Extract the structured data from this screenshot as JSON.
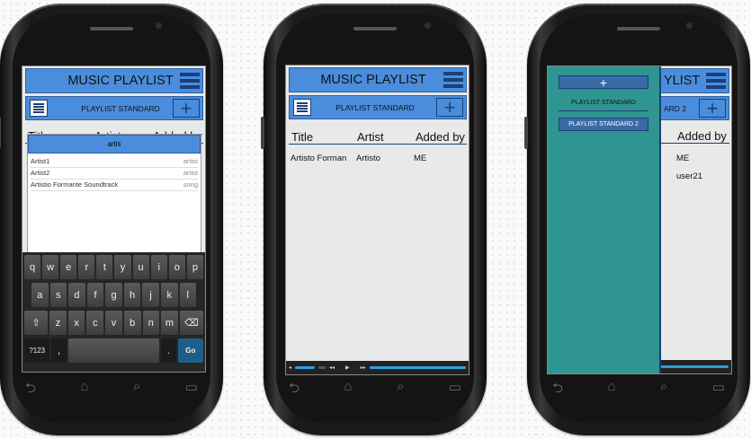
{
  "colors": {
    "header": "#4a8ddc",
    "header_border": "#2f5f9e",
    "drawer": "#2e9590",
    "screen_bg": "#e9e9ea"
  },
  "icons": {
    "menu": "hamburger-icon",
    "list": "list-icon",
    "add": "plus-icon",
    "back": "back-icon",
    "home": "home-icon",
    "search": "search-icon",
    "recent": "recent-apps-icon"
  },
  "header": {
    "title": "MUSIC PLAYLIST",
    "title_partial": "YLIST"
  },
  "subheader": {
    "playlist": "PLAYLIST STANDARD",
    "playlist_partial": "ARD 2",
    "plus": "+"
  },
  "columns": {
    "title": "Title",
    "artist": "Artist",
    "added_by": "Added by",
    "artist_partial": "Artis",
    "added_by_partial": "Added by"
  },
  "search": {
    "query": "artis",
    "results": [
      {
        "name": "Artist1",
        "type": "artist"
      },
      {
        "name": "Artist2",
        "type": "artist"
      },
      {
        "name": "Artistio Formante Soundtrack",
        "type": "song"
      }
    ]
  },
  "keyboard": {
    "row1": [
      "q",
      "w",
      "e",
      "r",
      "t",
      "y",
      "u",
      "i",
      "o",
      "p"
    ],
    "row2": [
      "a",
      "s",
      "d",
      "f",
      "g",
      "h",
      "j",
      "k",
      "l"
    ],
    "row3": [
      "⇧",
      "z",
      "x",
      "c",
      "v",
      "b",
      "n",
      "m",
      "⌫"
    ],
    "row4": [
      "?123",
      ",",
      "",
      ".",
      "Go"
    ]
  },
  "playlist_rows": [
    {
      "title": "Artisto Forman",
      "artist": "Artisto",
      "added_by": "ME"
    }
  ],
  "drawer": {
    "add": "+",
    "items": [
      "PLAYLIST STANDARD",
      "PLAYLIST STANDARD 2"
    ]
  },
  "drawer_rows": [
    {
      "added_by": "ME"
    },
    {
      "added_by": "user21"
    }
  ],
  "nav": {
    "back": "⮌",
    "home": "⌂",
    "search": "⌕",
    "recent": "▭"
  }
}
